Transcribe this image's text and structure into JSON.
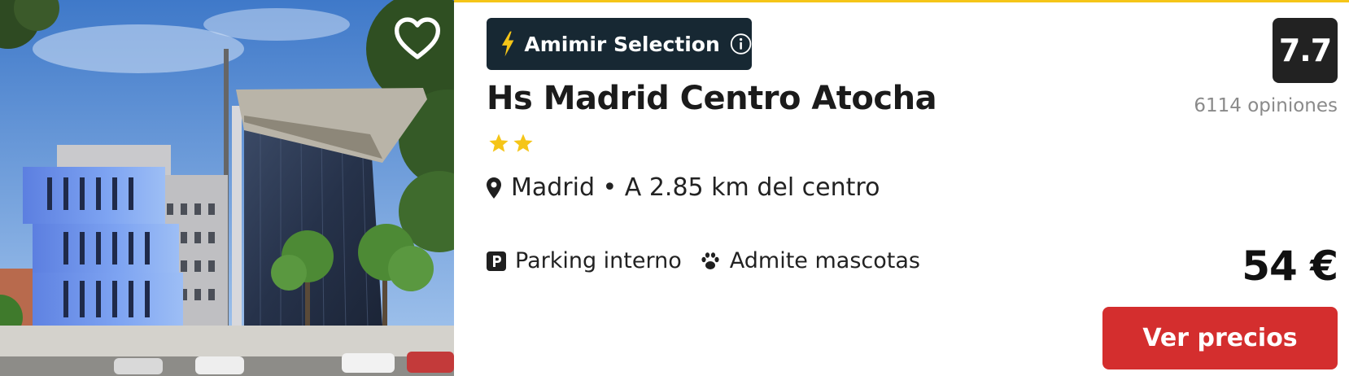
{
  "colors": {
    "accent_bar": "#f5c518",
    "badge_bg": "#172833",
    "badge_bolt": "#f5c518",
    "star": "#f5c518",
    "score_bg": "#222222",
    "cta_bg": "#d42e2e"
  },
  "photo": {
    "alt": "Hotel building exterior",
    "favorite_icon": "heart-outline-icon"
  },
  "badge": {
    "icon": "lightning-icon",
    "label": "Amimir Selection",
    "info_icon": "info-icon"
  },
  "hotel": {
    "name": "Hs Madrid Centro Atocha",
    "stars": 2,
    "location_icon": "map-pin-icon",
    "location": "Madrid • A 2.85 km del centro"
  },
  "amenities": [
    {
      "icon": "parking-icon",
      "label": "Parking interno"
    },
    {
      "icon": "paw-icon",
      "label": "Admite mascotas"
    }
  ],
  "rating": {
    "score": "7.7",
    "reviews": "6114 opiniones"
  },
  "price": "54 €",
  "cta_label": "Ver precios"
}
